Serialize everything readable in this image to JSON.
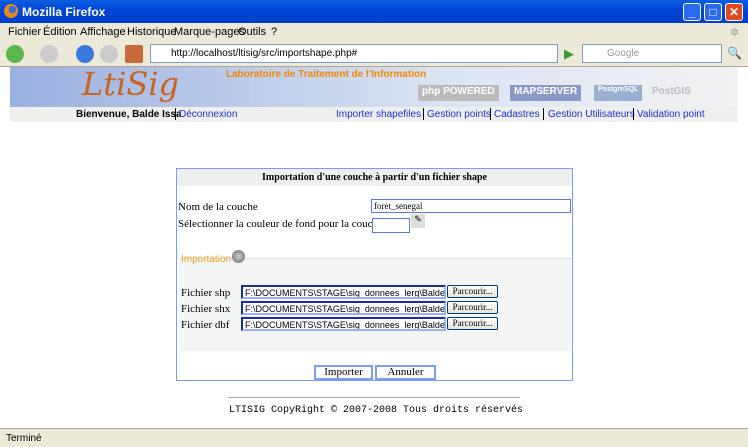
{
  "window": {
    "title": "Mozilla Firefox"
  },
  "menu": [
    "Fichier",
    "Édition",
    "Affichage",
    "Historique",
    "Marque-pages",
    "Outils",
    "?"
  ],
  "toolbar": {
    "url": "http://localhost/ltisig/src/importshape.php#",
    "search_placeholder": "Google"
  },
  "banner": {
    "logo": "LtiSig",
    "lab": "Laboratoire de Traitement de l'Information",
    "badges": [
      "php POWERED",
      "MAPSERVER",
      "PostgreSQL",
      "PostGIS"
    ]
  },
  "nav": {
    "welcome": "Bienvenue, Balde Issa",
    "logout": "Déconnexion",
    "links": [
      "Importer shapefiles",
      "Gestion points",
      "Cadastres",
      "Gestion Utilisateurs",
      "Validation point"
    ]
  },
  "form": {
    "title": "Importation d'une couche à partir d'un fichier shape",
    "name_label": "Nom de la couche",
    "name_value": "foret_senegal",
    "color_label": "Sélectionner la couleur de fond pour la couche",
    "color_value": "",
    "legend": "Importation",
    "files": [
      {
        "label": "Fichier shp",
        "value": "F:\\DOCUMENTS\\STAGE\\sig_donnees_lerg\\Balde\\FOF"
      },
      {
        "label": "Fichier shx",
        "value": "F:\\DOCUMENTS\\STAGE\\sig_donnees_lerg\\Balde\\FOF"
      },
      {
        "label": "Fichier dbf",
        "value": "F:\\DOCUMENTS\\STAGE\\sig_donnees_lerg\\Balde\\FOF"
      }
    ],
    "browse": "Parcourir...",
    "submit": "Importer",
    "cancel": "Annuler"
  },
  "footer": "LTISIG CopyRight © 2007-2008 Tous droits réservés",
  "status": "Terminé"
}
